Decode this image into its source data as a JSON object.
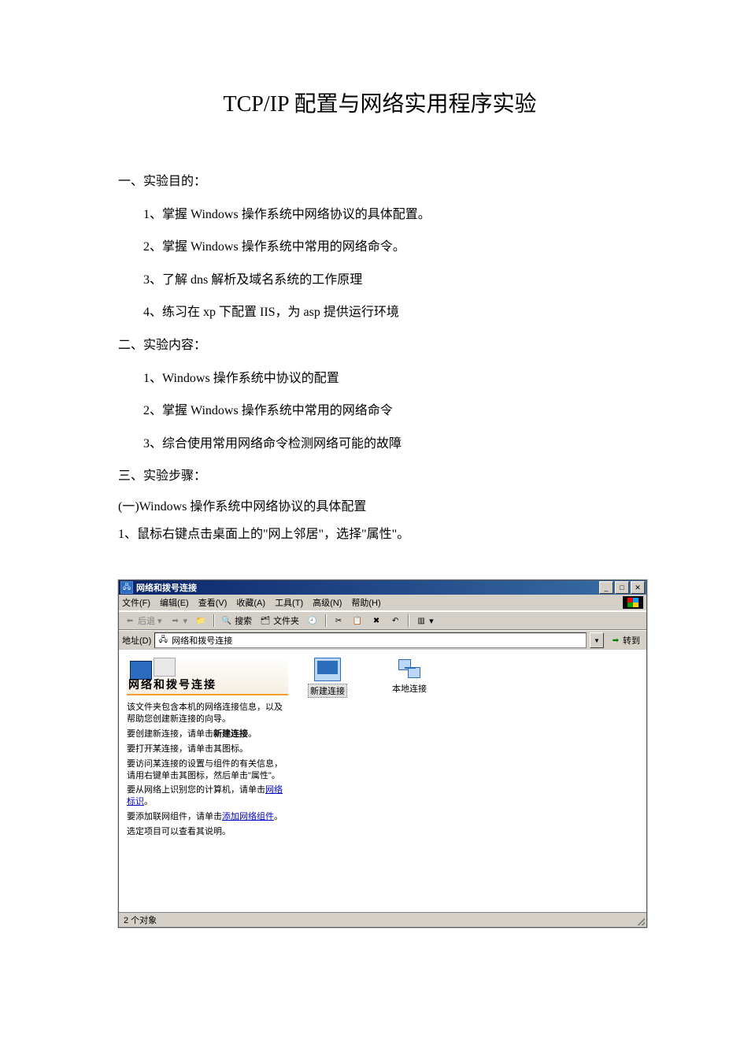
{
  "document": {
    "title": "TCP/IP 配置与网络实用程序实验",
    "s1": {
      "heading": "一、实验目的：",
      "items": [
        "1、掌握 Windows 操作系统中网络协议的具体配置。",
        "2、掌握 Windows 操作系统中常用的网络命令。",
        "3、了解 dns 解析及域名系统的工作原理",
        "4、练习在 xp 下配置 IIS，为 asp 提供运行环境"
      ]
    },
    "s2": {
      "heading": "二、实验内容：",
      "items": [
        "1、Windows 操作系统中协议的配置",
        "2、掌握 Windows 操作系统中常用的网络命令",
        "3、综合使用常用网络命令检测网络可能的故障"
      ]
    },
    "s3": {
      "heading": "三、实验步骤：",
      "sub1": "(一)Windows 操作系统中网络协议的具体配置",
      "sub2": "1、鼠标右键点击桌面上的\"网上邻居\"，选择\"属性\"。"
    }
  },
  "window": {
    "title": "网络和拨号连接",
    "menu": {
      "file": "文件(F)",
      "edit": "编辑(E)",
      "view": "查看(V)",
      "fav": "收藏(A)",
      "tools": "工具(T)",
      "adv": "高级(N)",
      "help": "帮助(H)"
    },
    "toolbar": {
      "back": "后退",
      "search": "搜索",
      "folders": "文件夹"
    },
    "address": {
      "label": "地址(D)",
      "value": "网络和拨号连接",
      "go": "转到"
    },
    "left": {
      "title": "网络和拨号连接",
      "p1": "该文件夹包含本机的网络连接信息，以及帮助您创建新连接的向导。",
      "p2a": "要创建新连接，请单击",
      "p2b": "新建连接",
      "p2c": "。",
      "p3": "要打开某连接，请单击其图标。",
      "p4": "要访问某连接的设置与组件的有关信息，请用右键单击其图标，然后单击\"属性\"。",
      "p5a": "要从网络上识别您的计算机，请单击",
      "p5link": "网络标识",
      "p5b": "。",
      "p6a": "要添加联网组件，请单击",
      "p6link": "添加网络组件",
      "p6b": "。",
      "p7": "选定项目可以查看其说明。"
    },
    "icons": {
      "newconn": "新建连接",
      "local": "本地连接"
    },
    "status": "2 个对象"
  }
}
